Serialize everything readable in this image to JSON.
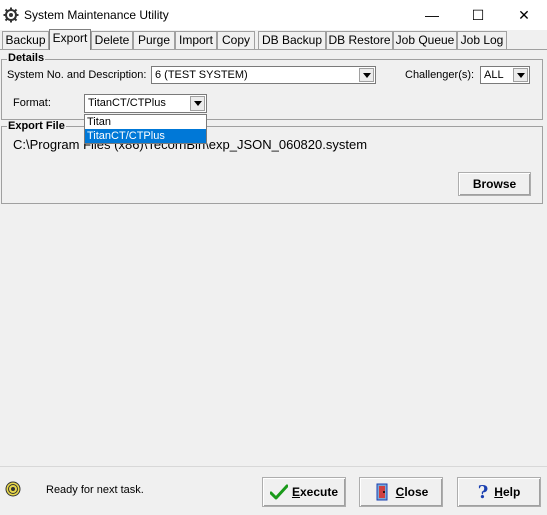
{
  "window": {
    "title": "System Maintenance Utility",
    "minimize_glyph": "—",
    "maximize_glyph": "☐",
    "close_glyph": "✕"
  },
  "tabs": [
    {
      "label": "Backup"
    },
    {
      "label": "Export",
      "active": true
    },
    {
      "label": "Delete"
    },
    {
      "label": "Purge"
    },
    {
      "label": "Import"
    },
    {
      "label": "Copy"
    },
    {
      "label": "DB Backup"
    },
    {
      "label": "DB Restore"
    },
    {
      "label": "Job Queue"
    },
    {
      "label": "Job Log"
    }
  ],
  "details": {
    "group_label": "Details",
    "system_label": "System No. and Description:",
    "system_value": "6  (TEST SYSTEM)",
    "challenger_label": "Challenger(s):",
    "challenger_value": "ALL",
    "format_label": "Format:",
    "format_value": "TitanCT/CTPlus",
    "format_options": [
      "Titan",
      "TitanCT/CTPlus"
    ],
    "format_selected": "TitanCT/CTPlus"
  },
  "export_file": {
    "group_label": "Export File",
    "path_visible": "C:\\Program Files (x86)\\TecornBin\\exp_JSON_060820.system",
    "browse_label": "Browse"
  },
  "status": {
    "text": "Ready for next task."
  },
  "buttons": {
    "execute_mnemonic": "E",
    "execute_rest": "xecute",
    "close_mnemonic": "C",
    "close_rest": "lose",
    "help_mnemonic": "H",
    "help_rest": "elp"
  },
  "colors": {
    "selection": "#0078d7",
    "execute_check": "#1a9a1a",
    "help_question": "#1a3fb0"
  }
}
